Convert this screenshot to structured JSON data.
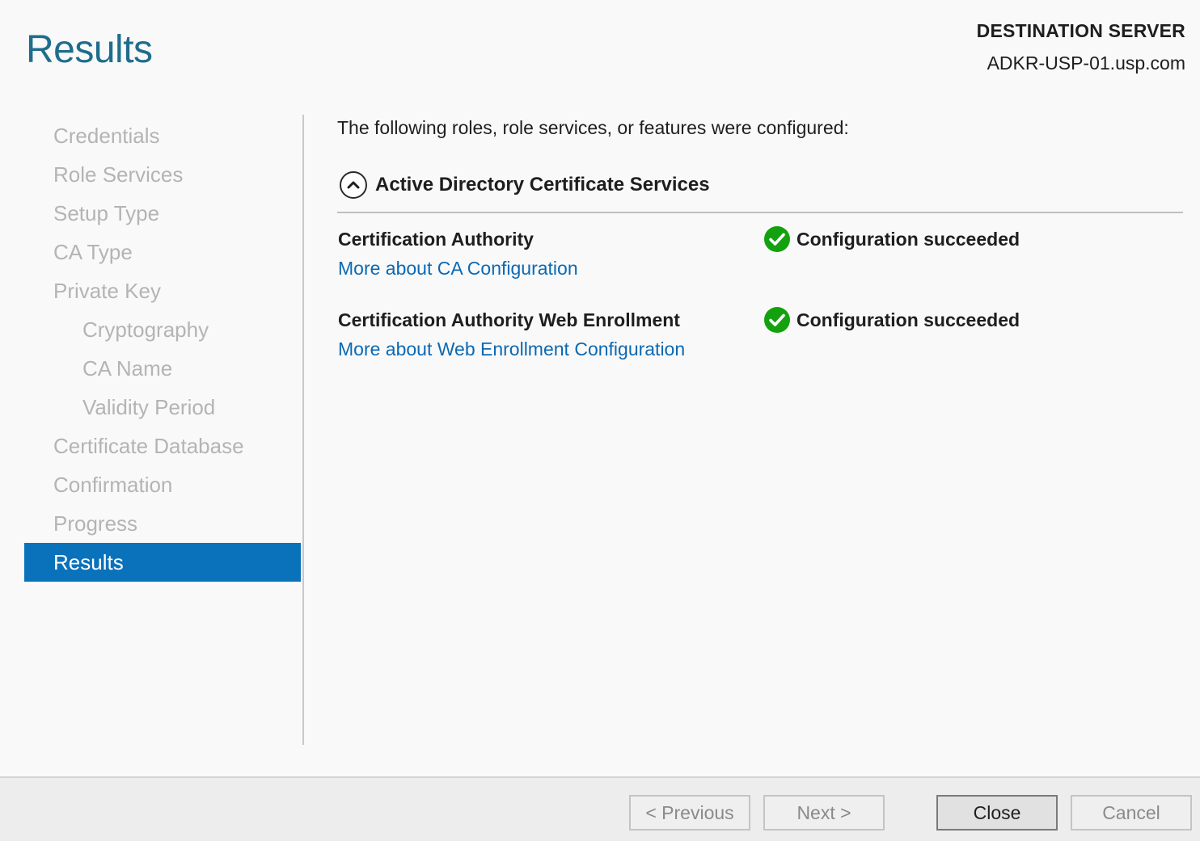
{
  "header": {
    "title": "Results",
    "destination_label": "DESTINATION SERVER",
    "destination_server": "ADKR-USP-01.usp.com"
  },
  "nav": {
    "items": [
      {
        "label": "Credentials",
        "indent": false,
        "active": false
      },
      {
        "label": "Role Services",
        "indent": false,
        "active": false
      },
      {
        "label": "Setup Type",
        "indent": false,
        "active": false
      },
      {
        "label": "CA Type",
        "indent": false,
        "active": false
      },
      {
        "label": "Private Key",
        "indent": false,
        "active": false
      },
      {
        "label": "Cryptography",
        "indent": true,
        "active": false
      },
      {
        "label": "CA Name",
        "indent": true,
        "active": false
      },
      {
        "label": "Validity Period",
        "indent": true,
        "active": false
      },
      {
        "label": "Certificate Database",
        "indent": false,
        "active": false
      },
      {
        "label": "Confirmation",
        "indent": false,
        "active": false
      },
      {
        "label": "Progress",
        "indent": false,
        "active": false
      },
      {
        "label": "Results",
        "indent": false,
        "active": true
      }
    ]
  },
  "content": {
    "intro": "The following roles, role services, or features were configured:",
    "group_title": "Active Directory Certificate Services",
    "roles": [
      {
        "name": "Certification Authority",
        "link": "More about CA Configuration",
        "status": "Configuration succeeded"
      },
      {
        "name": "Certification Authority Web Enrollment",
        "link": "More about Web Enrollment Configuration",
        "status": "Configuration succeeded"
      }
    ]
  },
  "footer": {
    "previous_label": "< Previous",
    "next_label": "Next >",
    "close_label": "Close",
    "cancel_label": "Cancel"
  },
  "colors": {
    "accent": "#0a72bb",
    "title": "#1f6d8c",
    "link": "#0b69b3",
    "success": "#13a10e"
  },
  "icons": {
    "collapse": "chevron-up-circle-icon",
    "status": "checkmark-circle-icon"
  }
}
